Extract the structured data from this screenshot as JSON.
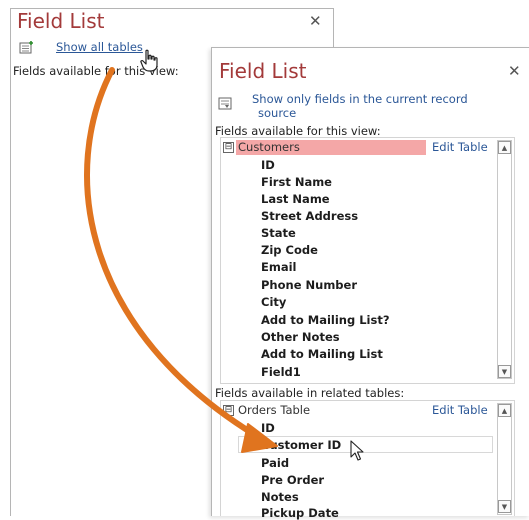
{
  "back_panel": {
    "title": "Field List",
    "close": "✕",
    "show_all_link": "Show all tables",
    "fields_available": "Fields available for this view:"
  },
  "front_panel": {
    "title": "Field List",
    "close": "✕",
    "show_only_link_line1": "Show only fields in the current record",
    "show_only_link_line2": "source",
    "fields_available": "Fields available for this view:",
    "current_table": {
      "minus": "⊟",
      "name": "Customers",
      "edit_link": "Edit Table",
      "fields": [
        "ID",
        "First Name",
        "Last Name",
        "Street Address",
        "State",
        "Zip Code",
        "Email",
        "Phone Number",
        "City",
        "Add to Mailing List?",
        "Other Notes",
        "Add to Mailing List",
        "Field1"
      ]
    },
    "related_label": "Fields available in related tables:",
    "related_table": {
      "minus": "⊟",
      "name": "Orders Table",
      "edit_link": "Edit Table",
      "fields": [
        "ID",
        "Customer ID",
        "Paid",
        "Pre Order",
        "Notes",
        "Pickup Date"
      ]
    }
  },
  "colors": {
    "title": "#a33a3a",
    "link": "#2b5797",
    "highlight": "#f4a7a7",
    "arrow": "#e0741f"
  }
}
